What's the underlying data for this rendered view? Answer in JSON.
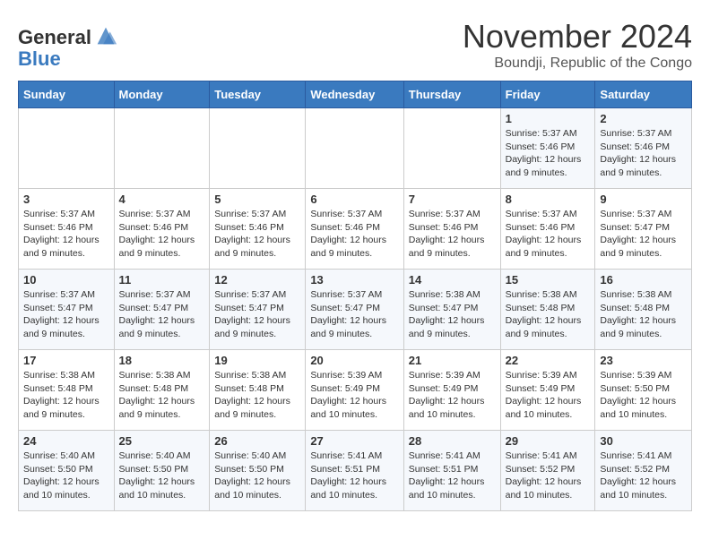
{
  "logo": {
    "line1": "General",
    "line2": "Blue"
  },
  "title": "November 2024",
  "location": "Boundji, Republic of the Congo",
  "days_header": [
    "Sunday",
    "Monday",
    "Tuesday",
    "Wednesday",
    "Thursday",
    "Friday",
    "Saturday"
  ],
  "weeks": [
    [
      {
        "day": "",
        "info": ""
      },
      {
        "day": "",
        "info": ""
      },
      {
        "day": "",
        "info": ""
      },
      {
        "day": "",
        "info": ""
      },
      {
        "day": "",
        "info": ""
      },
      {
        "day": "1",
        "info": "Sunrise: 5:37 AM\nSunset: 5:46 PM\nDaylight: 12 hours and 9 minutes."
      },
      {
        "day": "2",
        "info": "Sunrise: 5:37 AM\nSunset: 5:46 PM\nDaylight: 12 hours and 9 minutes."
      }
    ],
    [
      {
        "day": "3",
        "info": "Sunrise: 5:37 AM\nSunset: 5:46 PM\nDaylight: 12 hours and 9 minutes."
      },
      {
        "day": "4",
        "info": "Sunrise: 5:37 AM\nSunset: 5:46 PM\nDaylight: 12 hours and 9 minutes."
      },
      {
        "day": "5",
        "info": "Sunrise: 5:37 AM\nSunset: 5:46 PM\nDaylight: 12 hours and 9 minutes."
      },
      {
        "day": "6",
        "info": "Sunrise: 5:37 AM\nSunset: 5:46 PM\nDaylight: 12 hours and 9 minutes."
      },
      {
        "day": "7",
        "info": "Sunrise: 5:37 AM\nSunset: 5:46 PM\nDaylight: 12 hours and 9 minutes."
      },
      {
        "day": "8",
        "info": "Sunrise: 5:37 AM\nSunset: 5:46 PM\nDaylight: 12 hours and 9 minutes."
      },
      {
        "day": "9",
        "info": "Sunrise: 5:37 AM\nSunset: 5:47 PM\nDaylight: 12 hours and 9 minutes."
      }
    ],
    [
      {
        "day": "10",
        "info": "Sunrise: 5:37 AM\nSunset: 5:47 PM\nDaylight: 12 hours and 9 minutes."
      },
      {
        "day": "11",
        "info": "Sunrise: 5:37 AM\nSunset: 5:47 PM\nDaylight: 12 hours and 9 minutes."
      },
      {
        "day": "12",
        "info": "Sunrise: 5:37 AM\nSunset: 5:47 PM\nDaylight: 12 hours and 9 minutes."
      },
      {
        "day": "13",
        "info": "Sunrise: 5:37 AM\nSunset: 5:47 PM\nDaylight: 12 hours and 9 minutes."
      },
      {
        "day": "14",
        "info": "Sunrise: 5:38 AM\nSunset: 5:47 PM\nDaylight: 12 hours and 9 minutes."
      },
      {
        "day": "15",
        "info": "Sunrise: 5:38 AM\nSunset: 5:48 PM\nDaylight: 12 hours and 9 minutes."
      },
      {
        "day": "16",
        "info": "Sunrise: 5:38 AM\nSunset: 5:48 PM\nDaylight: 12 hours and 9 minutes."
      }
    ],
    [
      {
        "day": "17",
        "info": "Sunrise: 5:38 AM\nSunset: 5:48 PM\nDaylight: 12 hours and 9 minutes."
      },
      {
        "day": "18",
        "info": "Sunrise: 5:38 AM\nSunset: 5:48 PM\nDaylight: 12 hours and 9 minutes."
      },
      {
        "day": "19",
        "info": "Sunrise: 5:38 AM\nSunset: 5:48 PM\nDaylight: 12 hours and 9 minutes."
      },
      {
        "day": "20",
        "info": "Sunrise: 5:39 AM\nSunset: 5:49 PM\nDaylight: 12 hours and 10 minutes."
      },
      {
        "day": "21",
        "info": "Sunrise: 5:39 AM\nSunset: 5:49 PM\nDaylight: 12 hours and 10 minutes."
      },
      {
        "day": "22",
        "info": "Sunrise: 5:39 AM\nSunset: 5:49 PM\nDaylight: 12 hours and 10 minutes."
      },
      {
        "day": "23",
        "info": "Sunrise: 5:39 AM\nSunset: 5:50 PM\nDaylight: 12 hours and 10 minutes."
      }
    ],
    [
      {
        "day": "24",
        "info": "Sunrise: 5:40 AM\nSunset: 5:50 PM\nDaylight: 12 hours and 10 minutes."
      },
      {
        "day": "25",
        "info": "Sunrise: 5:40 AM\nSunset: 5:50 PM\nDaylight: 12 hours and 10 minutes."
      },
      {
        "day": "26",
        "info": "Sunrise: 5:40 AM\nSunset: 5:50 PM\nDaylight: 12 hours and 10 minutes."
      },
      {
        "day": "27",
        "info": "Sunrise: 5:41 AM\nSunset: 5:51 PM\nDaylight: 12 hours and 10 minutes."
      },
      {
        "day": "28",
        "info": "Sunrise: 5:41 AM\nSunset: 5:51 PM\nDaylight: 12 hours and 10 minutes."
      },
      {
        "day": "29",
        "info": "Sunrise: 5:41 AM\nSunset: 5:52 PM\nDaylight: 12 hours and 10 minutes."
      },
      {
        "day": "30",
        "info": "Sunrise: 5:41 AM\nSunset: 5:52 PM\nDaylight: 12 hours and 10 minutes."
      }
    ]
  ]
}
